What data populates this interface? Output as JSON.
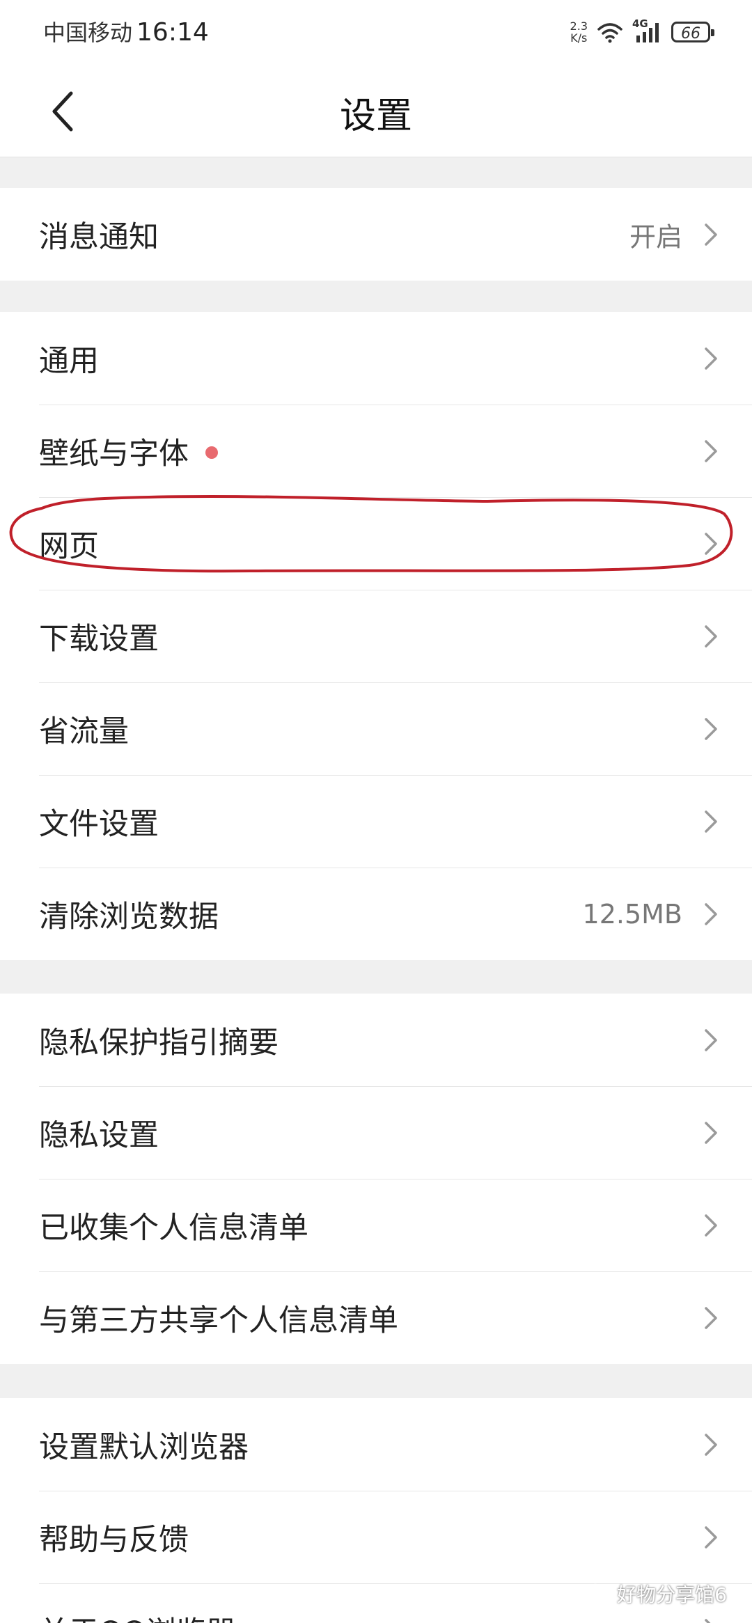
{
  "status_bar": {
    "carrier": "中国移动",
    "time": "16:14",
    "net_speed_value": "2.3",
    "net_speed_unit": "K/s",
    "network_type": "4G",
    "battery": "66"
  },
  "header": {
    "title": "设置",
    "back_icon": "chevron-left-icon"
  },
  "groups": [
    {
      "items": [
        {
          "label": "消息通知",
          "value": "开启"
        }
      ]
    },
    {
      "items": [
        {
          "label": "通用"
        },
        {
          "label": "壁纸与字体",
          "badge": "red-dot"
        },
        {
          "label": "网页"
        },
        {
          "label": "下载设置"
        },
        {
          "label": "省流量"
        },
        {
          "label": "文件设置"
        },
        {
          "label": "清除浏览数据",
          "value": "12.5MB"
        }
      ]
    },
    {
      "items": [
        {
          "label": "隐私保护指引摘要"
        },
        {
          "label": "隐私设置"
        },
        {
          "label": "已收集个人信息清单"
        },
        {
          "label": "与第三方共享个人信息清单"
        }
      ]
    },
    {
      "items": [
        {
          "label": "设置默认浏览器"
        },
        {
          "label": "帮助与反馈"
        },
        {
          "label": "关于QQ浏览器"
        }
      ]
    }
  ],
  "watermark": {
    "text": "好物分享馆6"
  },
  "colors": {
    "accent_dot": "#e86a6f",
    "annotation_ellipse": "#c0202a",
    "chevron": "#9a9a9a",
    "section_gap": "#f0f0f0"
  }
}
